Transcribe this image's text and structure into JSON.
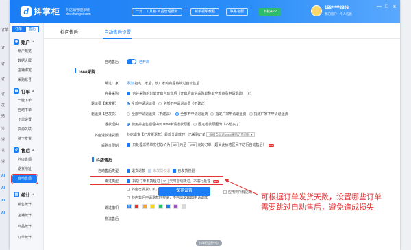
{
  "backdrop_left": [
    "订单",
    "订",
    "订",
    "订",
    "订",
    "发",
    "结",
    "达",
    "退",
    "发",
    "退",
    "AI",
    "AI",
    "AI",
    "AI"
  ],
  "header": {
    "logo_text": "抖掌柜",
    "logo_sub_1": "抖店铺管理系统",
    "logo_sub_2": "doushangui.com",
    "buttons": [
      "一对二工具箱·商品管理服务",
      "新手视频教程",
      "联系客服",
      "下载APP"
    ],
    "user_phone": "158*****3896",
    "user_tip": "我的账户 · 个人信息",
    "win_controls": [
      "—",
      "□",
      "✕"
    ]
  },
  "sidebar": {
    "tabs": [
      "订单",
      "售后"
    ],
    "groups": [
      {
        "label": "账户",
        "items": [
          "账户概览",
          "数据大屏",
          "店铺绑定",
          "采购账号"
        ]
      },
      {
        "label": "订单",
        "items": [
          "一键下单",
          "自动下单",
          "下单设置",
          "货源关联",
          "待下发货"
        ]
      },
      {
        "label": "售后",
        "items": [
          "抖店售后",
          "退货地址",
          "自动售后"
        ]
      },
      {
        "label": "统计",
        "items": [
          "销售统计",
          "店铺统计",
          "商品统计",
          "订单统计"
        ]
      }
    ],
    "active_item": "自动售后"
  },
  "content_tabs": [
    "抖店售后",
    "自动售后设置"
  ],
  "settings": {
    "auto_aftersale_label": "自动售后",
    "auto_aftersale_state": "已开启",
    "section_1688": "1688采购",
    "skip_vendor_label": "跳过厂家",
    "skip_vendor_link": "添加",
    "skip_vendor_text": "指定厂家后，该厂家的商品将跳过自动售后",
    "merge_label": "合并采购",
    "merge_text": "合并采购的订单开启自动售后（开启后会进采购单整单全部商品申请退款）",
    "refund_unshipped_label": "退运费【未发货】",
    "refund_unshipped_opts": [
      "全部申请退运费",
      "全部不申请退运费（不建议）"
    ],
    "refund_shipped_label": "退运费【已发货】",
    "refund_shipped_opts": [
      "全部申请退运费（不建议）",
      "全部不申请退运费",
      "指定厂家申请退运费",
      "指定厂家不申请退运费"
    ],
    "refund_reason_label": "退款理由",
    "refund_reason_opts": [
      "使用抖店售后理由到1688申请退款原因",
      "固定退款原因为【不想买了】"
    ],
    "refund_limit_label": "抖店退款退货限",
    "refund_limit_text_1": "抖店退货【已发货退款】是部分退款时，已采购订单",
    "refund_limit_dropdown": "根据自动退1688采购订单退款",
    "purchase_amount_label": "采购价限制",
    "purchase_amount_text_1": "只处理采购单实付总价为",
    "purchase_amount_val_1": "10",
    "purchase_amount_unit_1": "元至",
    "purchase_amount_val_2": "100",
    "purchase_amount_text_2": "元的订单（超出此价格区间不进行自动售后）",
    "section_douyin": "抖店售后",
    "aftersale_type_label": "自动售后类型",
    "aftersale_type_opts": [
      "退货退款",
      "未发货仅退",
      "已发货仅退"
    ],
    "skip_type_label": "跳过类型",
    "skip_type_text_1": "抖店订单发货超过",
    "skip_type_days": "10",
    "skip_type_text_2": "天时自动跳过，不进行处理",
    "skip_opt_1": "抖店已发货订单，厂家退款后不自动处理抖店退款",
    "skip_opt_2": "抖店售后申请退款时买家，不自动退1688申请退款",
    "skip_color_label": "跳过旗帜",
    "skip_color_first": "全",
    "skip_colors": [
      "#e63434",
      "#f5a623",
      "#f5d523",
      "#2ebd6b",
      "#1b7df5",
      "#9b59b6",
      "#d9d9d9"
    ],
    "last_label": "物流售后"
  },
  "annotation": {
    "line_1": "可根据订单发货天数，设置哪些订单",
    "line_2": "需要跳过自动售后，避免造成损失"
  },
  "save_button": "保存设置",
  "save_extra": "应用到所有店铺",
  "footer_pill": "抖掌柜运营中心"
}
